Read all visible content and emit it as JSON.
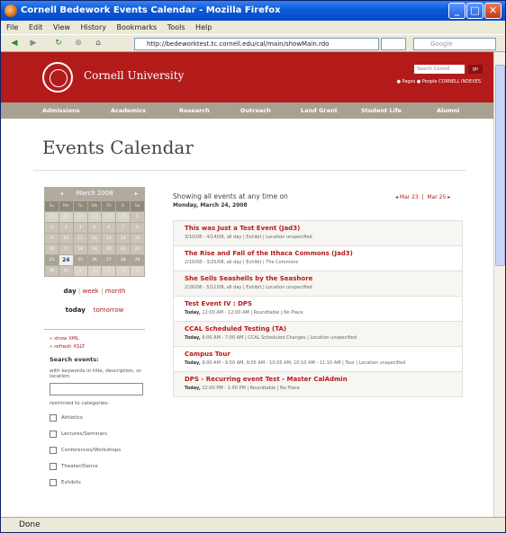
{
  "browser": {
    "title": "Cornell Bedework Events Calendar - Mozilla Firefox",
    "menu": [
      "File",
      "Edit",
      "View",
      "History",
      "Bookmarks",
      "Tools",
      "Help"
    ],
    "url": "http://bedeworktest.tc.cornell.edu/cal/main/showMain.rdo",
    "search_placeholder": "Google",
    "status": "Done"
  },
  "header": {
    "university": "Cornell University",
    "search_label": "Search Cornell",
    "search_button": "go",
    "radio_pages": "Pages",
    "radio_people": "People",
    "radio_links": "CORNELL INDEXES"
  },
  "global_nav": [
    "Admissions",
    "Academics",
    "Research",
    "Outreach",
    "Land Grant",
    "Student Life",
    "Alumni"
  ],
  "page": {
    "title": "Events Calendar"
  },
  "mini_calendar": {
    "month": "March 2008",
    "prev": "◂",
    "next": "▸",
    "days_of_week": [
      "Su",
      "Mo",
      "Tu",
      "We",
      "Th",
      "Fr",
      "Sa"
    ],
    "weeks": [
      [
        "24",
        "25",
        "26",
        "27",
        "28",
        "29",
        "1"
      ],
      [
        "2",
        "3",
        "4",
        "5",
        "6",
        "7",
        "8"
      ],
      [
        "9",
        "10",
        "11",
        "12",
        "13",
        "14",
        "15"
      ],
      [
        "16",
        "17",
        "18",
        "19",
        "20",
        "21",
        "22"
      ],
      [
        "23",
        "24",
        "25",
        "26",
        "27",
        "28",
        "29"
      ],
      [
        "30",
        "31",
        "1",
        "2",
        "3",
        "4",
        "5"
      ]
    ],
    "selected": "24"
  },
  "views": {
    "day": "day",
    "week": "week",
    "month": "month",
    "today": "today",
    "tomorrow": "tomorrow"
  },
  "sidebar": {
    "show_xml": "show XML",
    "refresh_xslt": "refresh XSLT",
    "search_title": "Search events:",
    "search_hint": "with keywords in title, description, or location:",
    "restrict_label": "restricted to categories:",
    "categories": [
      "Athletics",
      "Lectures/Seminars",
      "Conferences/Workshops",
      "Theater/Dance",
      "Exhibits"
    ]
  },
  "listing": {
    "showing": "Showing all events at any time on",
    "date": "Monday, March 24, 2008",
    "prev_link": "◂ Mar 23",
    "next_link": "Mar 25 ▸",
    "events": [
      {
        "title": "This was Just a Test Event (Jad3)",
        "prefix": "",
        "detail": "3/10/08 - 4/14/08, all day | Exhibit | Location unspecified"
      },
      {
        "title": "The Rise and Fall of the Ithaca Commons (Jad3)",
        "prefix": "",
        "detail": "2/10/08 - 3/25/08, all day | Exhibit | The Commons"
      },
      {
        "title": "She Sells Seashells by the Seashore",
        "prefix": "",
        "detail": "2/26/08 - 5/11/08, all day | Exhibit | Location unspecified"
      },
      {
        "title": "Test Event IV : DPS",
        "prefix": "Today,",
        "detail": "12:00 AM - 12:00 AM | Roundtable | No Place"
      },
      {
        "title": "CCAL Scheduled Testing (TA)",
        "prefix": "Today,",
        "detail": "6:00 AM - 7:00 AM | CCAL Scheduled Changes | Location unspecified"
      },
      {
        "title": "Campus Tour",
        "prefix": "Today,",
        "detail": "9:00 AM - 9:50 AM, 9:05 AM - 10:05 AM, 10:10 AM - 11:10 AM | Tour | Location unspecified"
      },
      {
        "title": "DPS - Recurring event Test - Master CalAdmin",
        "prefix": "Today,",
        "detail": "12:00 PM - 1:00 PM | Roundtable | No Place"
      }
    ]
  }
}
